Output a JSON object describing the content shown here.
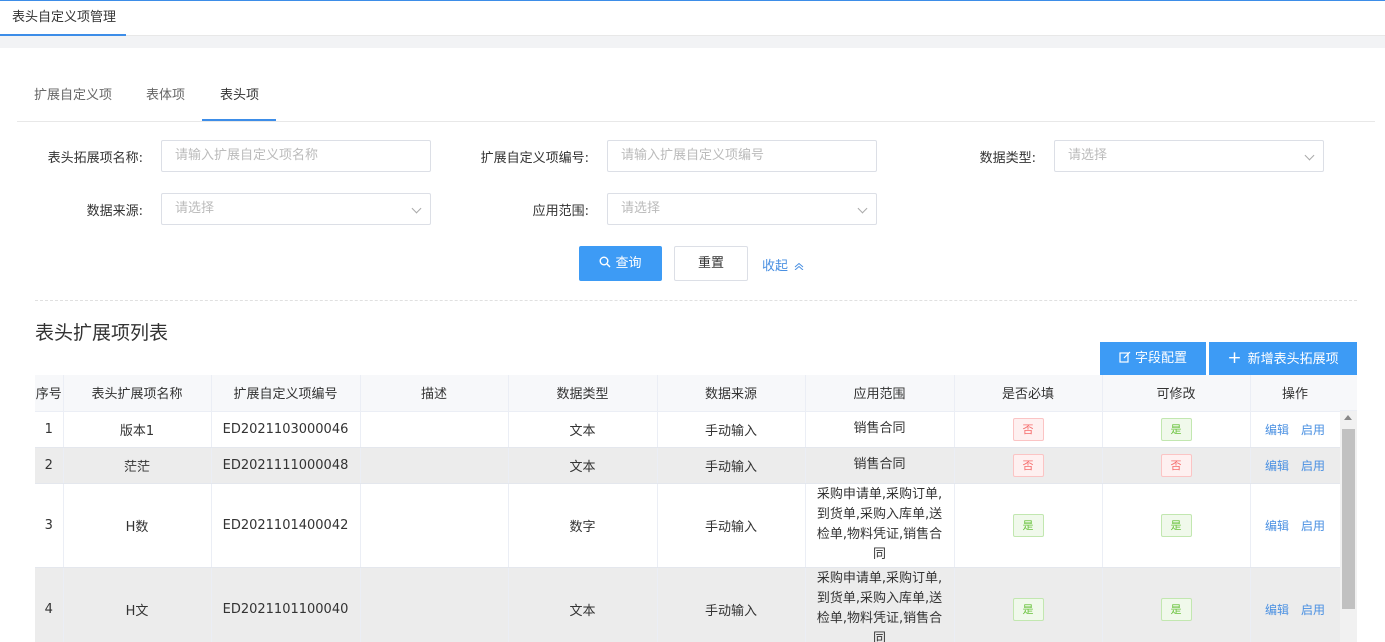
{
  "top_tab": "表头自定义项管理",
  "subtabs": [
    "扩展自定义项",
    "表体项",
    "表头项"
  ],
  "filters": {
    "name_label": "表头拓展项名称:",
    "name_placeholder": "请输入扩展自定义项名称",
    "code_label": "扩展自定义项编号:",
    "code_placeholder": "请输入扩展自定义项编号",
    "type_label": "数据类型:",
    "type_placeholder": "请选择",
    "source_label": "数据来源:",
    "source_placeholder": "请选择",
    "scope_label": "应用范围:",
    "scope_placeholder": "请选择"
  },
  "buttons": {
    "search": "查询",
    "reset": "重置",
    "collapse": "收起",
    "field_config": "字段配置",
    "add_new": "新增表头拓展项"
  },
  "list_title": "表头扩展项列表",
  "columns": [
    "序号",
    "表头扩展项名称",
    "扩展自定义项编号",
    "描述",
    "数据类型",
    "数据来源",
    "应用范围",
    "是否必填",
    "可修改",
    "操作"
  ],
  "rows": [
    {
      "no": "1",
      "name": "版本1",
      "code": "ED2021103000046",
      "desc": "",
      "type": "文本",
      "source": "手动输入",
      "scope": "销售合同",
      "required": "否",
      "editable": "是"
    },
    {
      "no": "2",
      "name": "茫茫",
      "code": "ED2021111000048",
      "desc": "",
      "type": "文本",
      "source": "手动输入",
      "scope": "销售合同",
      "required": "否",
      "editable": "否"
    },
    {
      "no": "3",
      "name": "H数",
      "code": "ED2021101400042",
      "desc": "",
      "type": "数字",
      "source": "手动输入",
      "scope": "采购申请单,采购订单,到货单,采购入库单,送检单,物料凭证,销售合同",
      "required": "是",
      "editable": "是"
    },
    {
      "no": "4",
      "name": "H文",
      "code": "ED2021101100040",
      "desc": "",
      "type": "文本",
      "source": "手动输入",
      "scope": "采购申请单,采购订单,到货单,采购入库单,送检单,物料凭证,销售合同",
      "required": "是",
      "editable": "是"
    }
  ],
  "row_actions": {
    "edit": "编辑",
    "enable": "启用"
  },
  "colors": {
    "primary": "#3d9bf5",
    "link": "#4a90e2",
    "tag_no": "#f56c6c",
    "tag_yes": "#67c23a"
  }
}
